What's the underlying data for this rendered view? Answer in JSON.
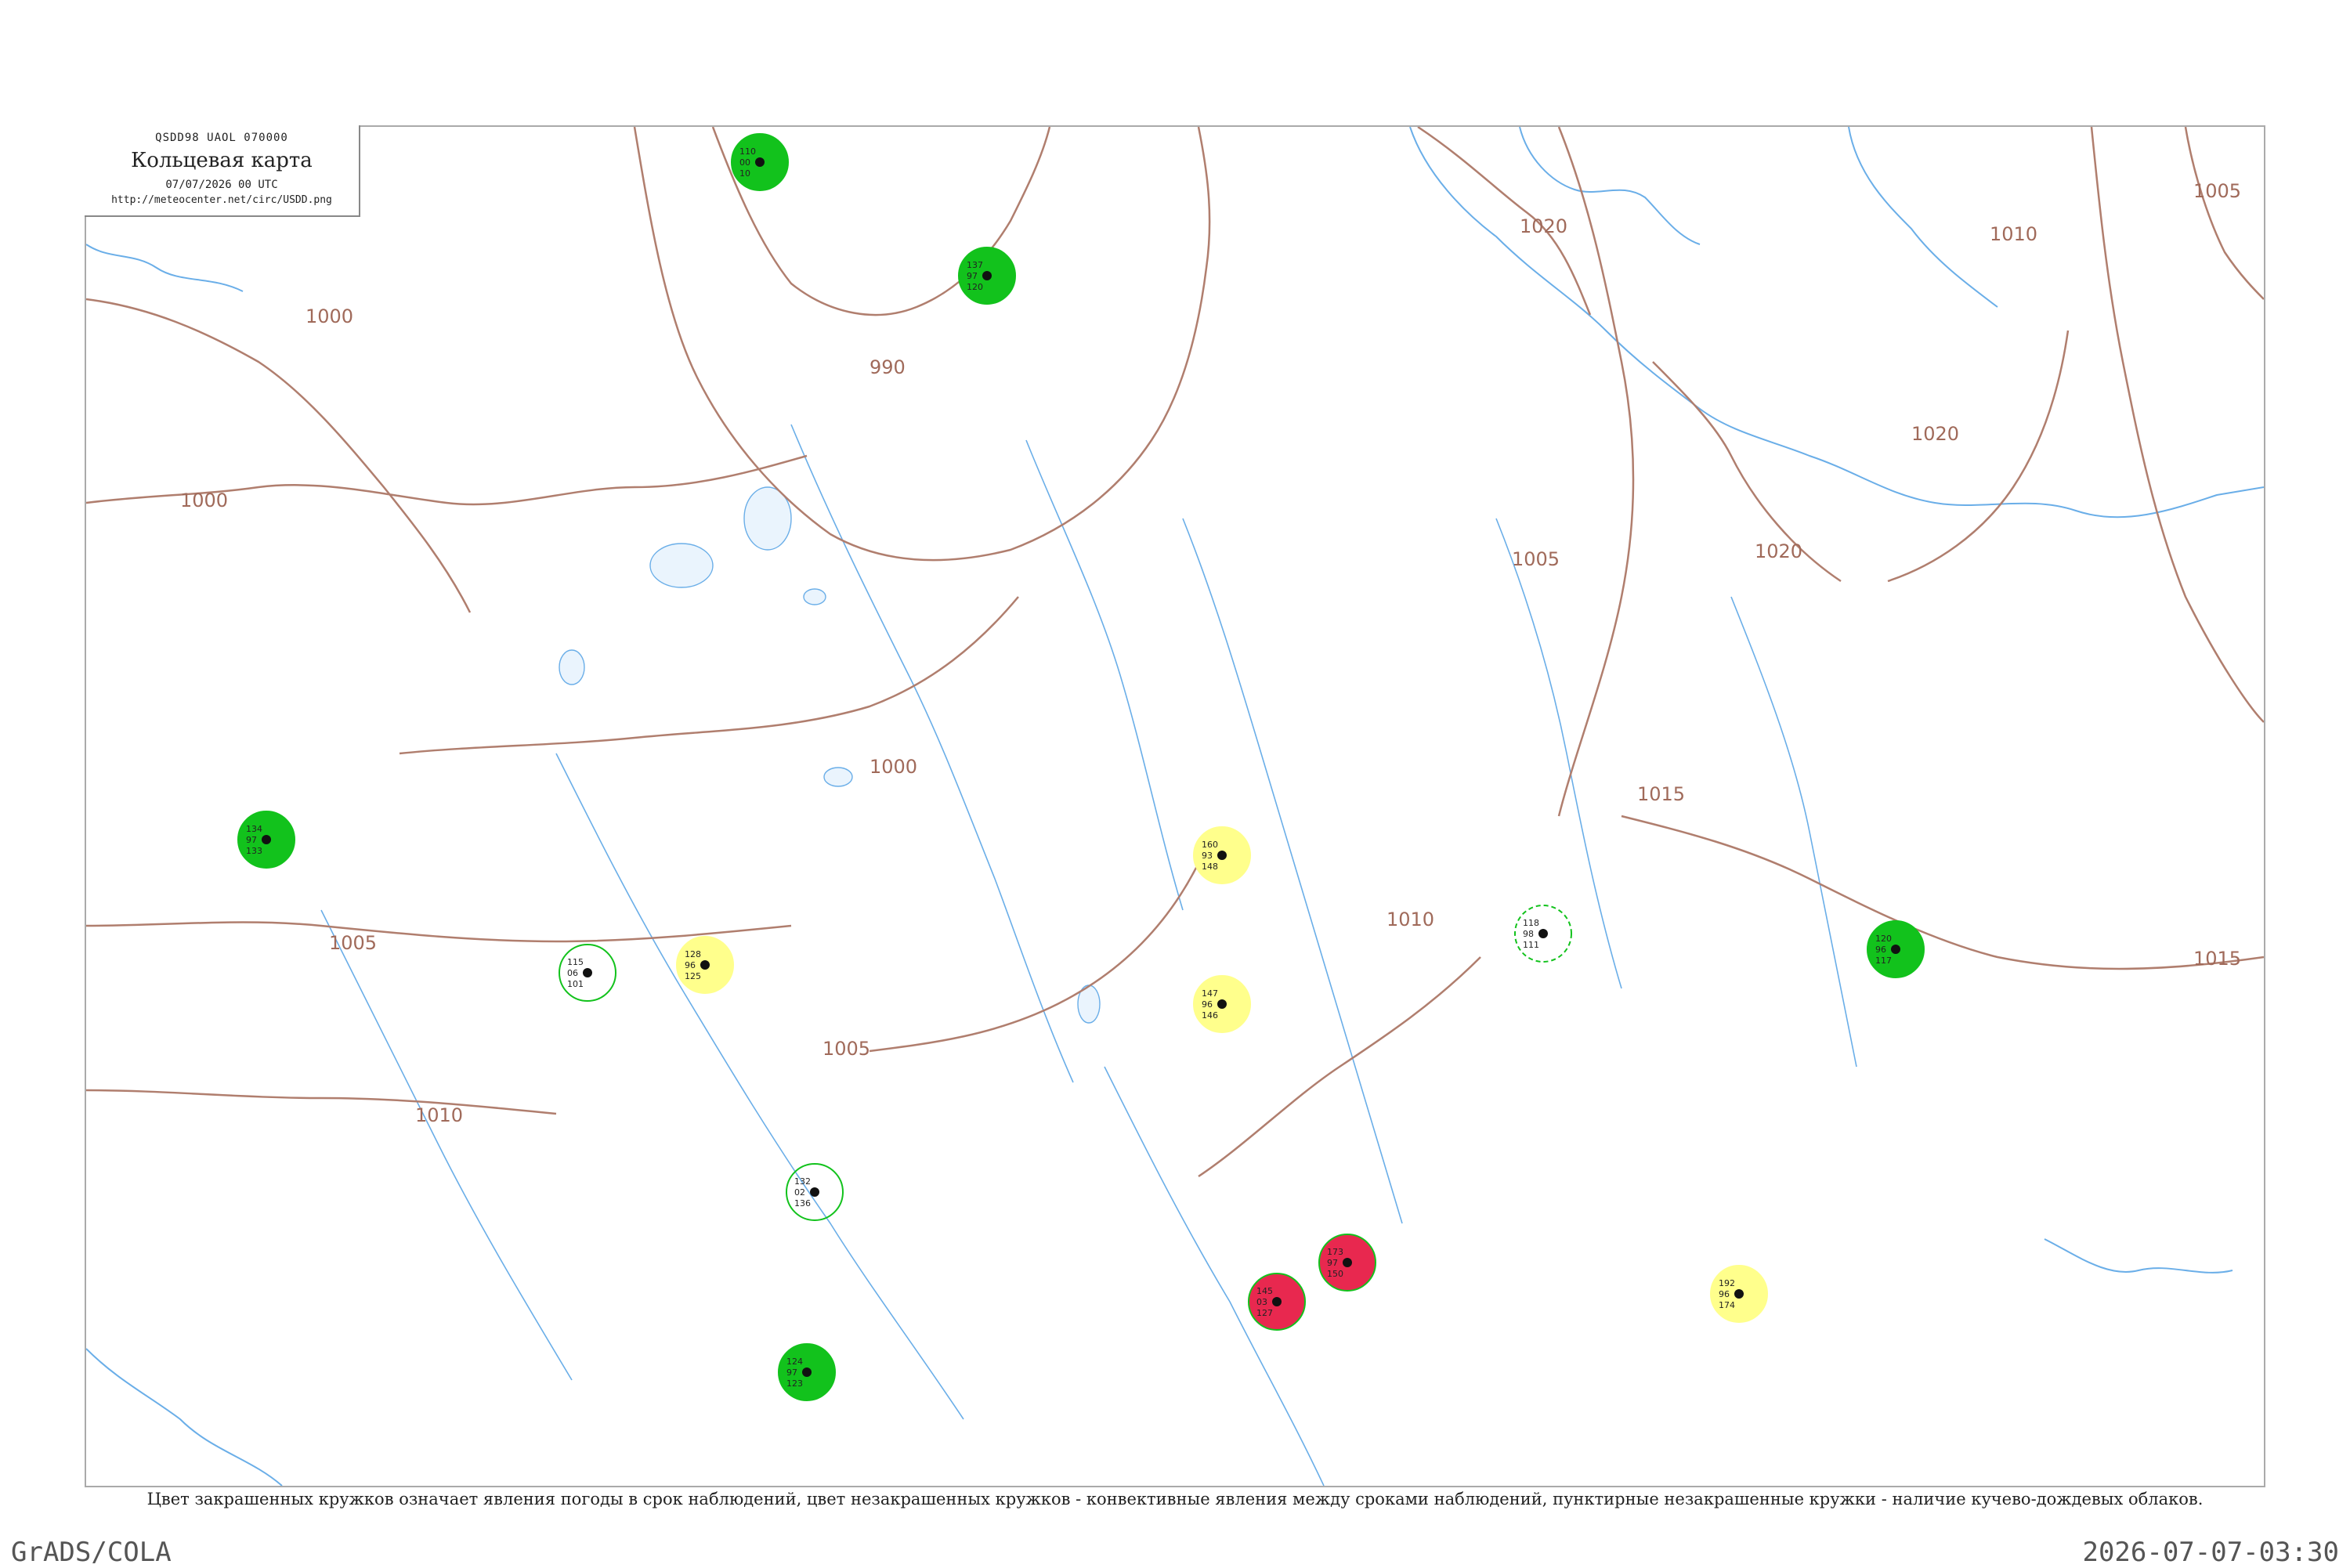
{
  "header": {
    "code": "QSDD98  UAOL  070000",
    "title": "Кольцевая карта",
    "date": "07/07/2026 00 UTC",
    "url": "http://meteocenter.net/circ/USDD.png"
  },
  "caption": "Цвет закрашенных кружков означает явления погоды в срок наблюдений, цвет незакрашенных кружков - конвективные явления между сроками наблюдений, пунктирные незакрашенные кружки - наличие кучево-дождевых облаков.",
  "footer": {
    "left": "GrADS/COLA",
    "right": "2026-07-07-03:30"
  },
  "colors": {
    "rain_fill": "#12c21c",
    "drizzle_fill": "#ffff8c",
    "thunder_fill": "#e8284f",
    "isobar": "#b07e6e",
    "water": "#6aaee8"
  },
  "isobars": [
    {
      "value": "1000"
    },
    {
      "value": "1000"
    },
    {
      "value": "990"
    },
    {
      "value": "1000"
    },
    {
      "value": "1005"
    },
    {
      "value": "1005"
    },
    {
      "value": "1010"
    },
    {
      "value": "1010"
    },
    {
      "value": "1015"
    },
    {
      "value": "1015"
    },
    {
      "value": "1020"
    },
    {
      "value": "1020"
    },
    {
      "value": "1020"
    },
    {
      "value": "1010"
    },
    {
      "value": "1005"
    },
    {
      "value": "1005"
    }
  ],
  "stations": [
    {
      "v": [
        "110",
        "00",
        "10"
      ],
      "s": "rain"
    },
    {
      "v": [
        "137",
        "97",
        "120"
      ],
      "s": "rain"
    },
    {
      "v": [
        "128",
        "96",
        "125"
      ],
      "s": "drizzle"
    },
    {
      "v": [
        "132",
        "02",
        "136"
      ],
      "s": "open"
    },
    {
      "v": [
        "124",
        "97",
        "123"
      ],
      "s": "rain"
    },
    {
      "v": [
        "115",
        "06",
        "101"
      ],
      "s": "open"
    },
    {
      "v": [
        "160",
        "93",
        "148"
      ],
      "s": "drizzle"
    },
    {
      "v": [
        "145",
        "03",
        "127"
      ],
      "s": "thunder"
    },
    {
      "v": [
        "118",
        "98",
        "111"
      ],
      "s": "dashed"
    },
    {
      "v": [
        "147",
        "96",
        "146"
      ],
      "s": "drizzle"
    },
    {
      "v": [
        "134",
        "97",
        "133"
      ],
      "s": "rain"
    },
    {
      "v": [
        "173",
        "97",
        "150"
      ],
      "s": "thunder"
    },
    {
      "v": [
        "120",
        "96",
        "117"
      ],
      "s": "rain"
    },
    {
      "v": [
        "192",
        "96",
        "174"
      ],
      "s": "drizzle"
    }
  ]
}
